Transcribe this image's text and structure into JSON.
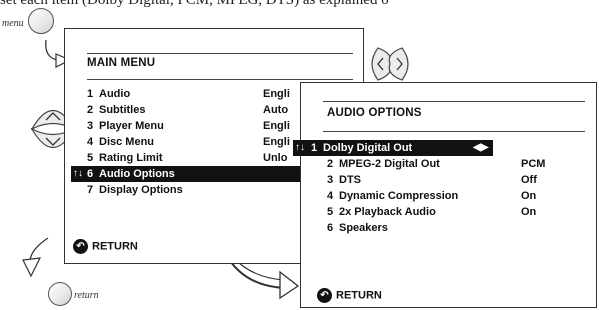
{
  "top_text": "set each item (Dolby Digital, PCM, MPEG, DTS) as explained o",
  "remote": {
    "menu_label": "menu",
    "return_label": "return"
  },
  "main_menu": {
    "title": "MAIN MENU",
    "items": [
      {
        "num": "1",
        "label": "Audio",
        "value": "Engli"
      },
      {
        "num": "2",
        "label": "Subtitles",
        "value": "Auto"
      },
      {
        "num": "3",
        "label": "Player Menu",
        "value": "Engli"
      },
      {
        "num": "4",
        "label": "Disc Menu",
        "value": "Engli"
      },
      {
        "num": "5",
        "label": "Rating Limit",
        "value": "Unlo"
      },
      {
        "num": "6",
        "label": "Audio Options",
        "value": ""
      },
      {
        "num": "7",
        "label": "Display Options",
        "value": ""
      }
    ],
    "selected_marker": "↑↓",
    "return_label": "RETURN"
  },
  "audio_options": {
    "title": "AUDIO OPTIONS",
    "selected_marker": "↑↓",
    "lr_arrows": "◀▶",
    "items": [
      {
        "num": "1",
        "label": "Dolby Digital Out",
        "value": ""
      },
      {
        "num": "2",
        "label": "MPEG-2 Digital Out",
        "value": "PCM"
      },
      {
        "num": "3",
        "label": "DTS",
        "value": "Off"
      },
      {
        "num": "4",
        "label": "Dynamic Compression",
        "value": "On"
      },
      {
        "num": "5",
        "label": "2x Playback Audio",
        "value": "On"
      },
      {
        "num": "6",
        "label": "Speakers",
        "value": ""
      }
    ],
    "return_label": "RETURN"
  }
}
